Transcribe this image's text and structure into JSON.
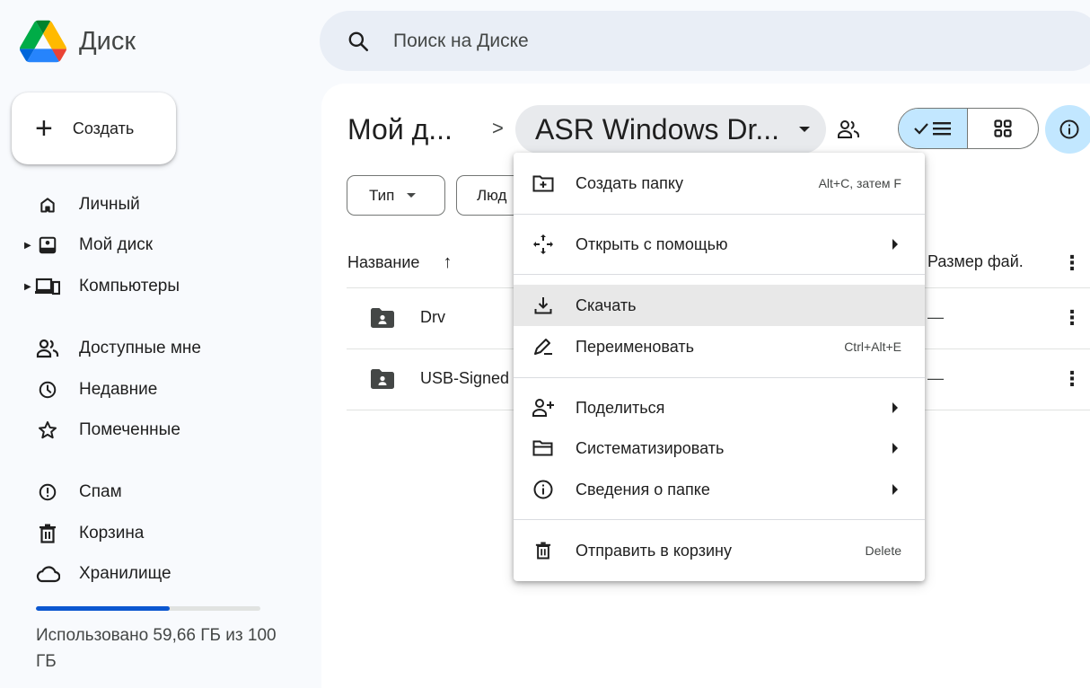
{
  "app": {
    "brand": "Диск"
  },
  "search": {
    "placeholder": "Поиск на Диске"
  },
  "create_button": {
    "label": "Создать"
  },
  "sidebar": {
    "items": [
      {
        "label": "Личный",
        "icon": "home-icon"
      },
      {
        "label": "Мой диск",
        "icon": "my-drive-icon"
      },
      {
        "label": "Компьютеры",
        "icon": "computers-icon"
      },
      {
        "label": "Доступные мне",
        "icon": "shared-people-icon"
      },
      {
        "label": "Недавние",
        "icon": "clock-icon"
      },
      {
        "label": "Помеченные",
        "icon": "star-icon"
      },
      {
        "label": "Спам",
        "icon": "spam-icon"
      },
      {
        "label": "Корзина",
        "icon": "trash-icon"
      },
      {
        "label": "Хранилище",
        "icon": "cloud-icon"
      }
    ]
  },
  "storage": {
    "used_fraction": 0.5966,
    "text": "Использовано 59,66 ГБ из 100 ГБ"
  },
  "breadcrumb": {
    "parent": "Мой д...",
    "separator": ">",
    "current": "ASR Windows Dr..."
  },
  "filters": {
    "type": "Тип",
    "people": "Люд"
  },
  "table": {
    "header_name": "Название",
    "header_sort": "↑",
    "header_size": "Размер фай.",
    "header_more": "⋮",
    "rows": [
      {
        "name": "Drv",
        "size": "—",
        "more": "⋮"
      },
      {
        "name": "USB-Signed",
        "size": "—",
        "more": "⋮"
      }
    ]
  },
  "context_menu": {
    "items": [
      {
        "label": "Создать папку",
        "shortcut": "Alt+C, затем F",
        "icon": "new-folder-icon"
      },
      {
        "label": "Открыть с помощью",
        "icon": "open-with-icon",
        "submenu": true
      },
      {
        "label": "Скачать",
        "icon": "download-icon",
        "highlighted": true
      },
      {
        "label": "Переименовать",
        "shortcut": "Ctrl+Alt+E",
        "icon": "rename-icon"
      },
      {
        "label": "Поделиться",
        "icon": "share-person-icon",
        "submenu": true
      },
      {
        "label": "Систематизировать",
        "icon": "organize-folder-icon",
        "submenu": true
      },
      {
        "label": "Сведения о папке",
        "icon": "info-icon",
        "submenu": true
      },
      {
        "label": "Отправить в корзину",
        "shortcut": "Delete",
        "icon": "trash-icon"
      }
    ]
  },
  "colors": {
    "accent": "#0b57d0",
    "selected_toggle": "#c2e7ff",
    "search_bg": "#e9eef6",
    "menu_highlight": "#e8e8e8"
  }
}
